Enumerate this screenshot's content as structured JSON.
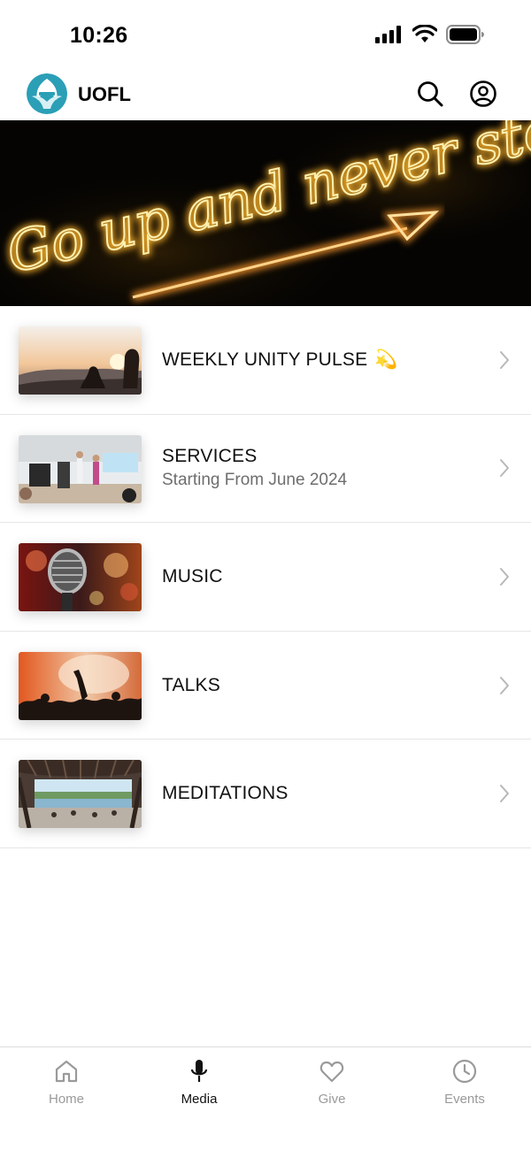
{
  "status_bar": {
    "time": "10:26"
  },
  "header": {
    "app_title": "UOFL",
    "logo_icon": "uofl-logo-icon",
    "search_icon": "search-icon",
    "profile_icon": "profile-icon"
  },
  "hero": {
    "neon_text": "Go up and never stop",
    "image": "neon-sign-banner"
  },
  "media_list": [
    {
      "title": "WEEKLY UNITY PULSE",
      "emoji": "💫",
      "subtitle": "",
      "thumbnail": "sunset-silhouettes"
    },
    {
      "title": "SERVICES",
      "subtitle": "Starting From June 2024",
      "thumbnail": "stage-service"
    },
    {
      "title": "MUSIC",
      "subtitle": "",
      "thumbnail": "microphone"
    },
    {
      "title": "TALKS",
      "subtitle": "",
      "thumbnail": "concert-crowd"
    },
    {
      "title": "MEDITATIONS",
      "subtitle": "",
      "thumbnail": "lake-pavilion-meditation"
    }
  ],
  "tab_bar": {
    "active": "Media",
    "tabs": [
      {
        "label": "Home",
        "icon": "home-icon"
      },
      {
        "label": "Media",
        "icon": "microphone-icon"
      },
      {
        "label": "Give",
        "icon": "heart-icon"
      },
      {
        "label": "Events",
        "icon": "clock-icon"
      }
    ]
  },
  "colors": {
    "neon": "#ffcf4a",
    "logo_teal": "#2aa1b8",
    "active_tab": "#111111",
    "inactive_tab": "#9a9a9a"
  }
}
